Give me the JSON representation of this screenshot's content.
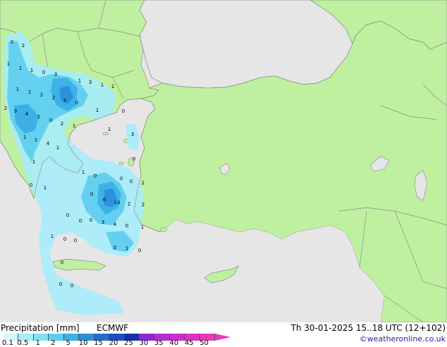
{
  "legend": {
    "title": "Precipitation [mm]",
    "model": "ECMWF",
    "ticks": [
      "0.1",
      "0.5",
      "1",
      "2",
      "5",
      "10",
      "15",
      "20",
      "25",
      "30",
      "35",
      "40",
      "45",
      "50"
    ],
    "colors": [
      "#d8f6ff",
      "#a6ecfa",
      "#82e0f4",
      "#5ccdef",
      "#3ab0e6",
      "#2a8fdb",
      "#1f6ed0",
      "#1a4fc2",
      "#102fa8",
      "#8c28d4",
      "#b82ad8",
      "#d22ad0",
      "#e02ec8",
      "#e838b8"
    ]
  },
  "valid_time": "Th 30-01-2025 15..18 UTC (12+102)",
  "credit": "©weatheronline.co.uk",
  "colors": {
    "land": "#bff0a0",
    "land_outside": "#eeeeee",
    "sea": "#e6e6e6",
    "border": "#8a8a8a"
  },
  "map_values": [
    "0",
    "2",
    "1",
    "1",
    "1",
    "0",
    "3",
    "1",
    "3",
    "1",
    "1",
    "1",
    "1",
    "2",
    "2",
    "3",
    "0",
    "2",
    "3",
    "4",
    "1",
    "0",
    "2",
    "1",
    "1",
    "1",
    "3",
    "1",
    "1",
    "4",
    "1",
    "0",
    "0",
    "1",
    "0",
    "1",
    "1",
    "0",
    "0",
    "0",
    "1",
    "0",
    "6",
    "10",
    "2",
    "2",
    "0",
    "3",
    "4",
    "0",
    "1",
    "0",
    "0",
    "1",
    "0",
    "0",
    "0",
    "1",
    "0",
    "0",
    "0",
    "0"
  ]
}
